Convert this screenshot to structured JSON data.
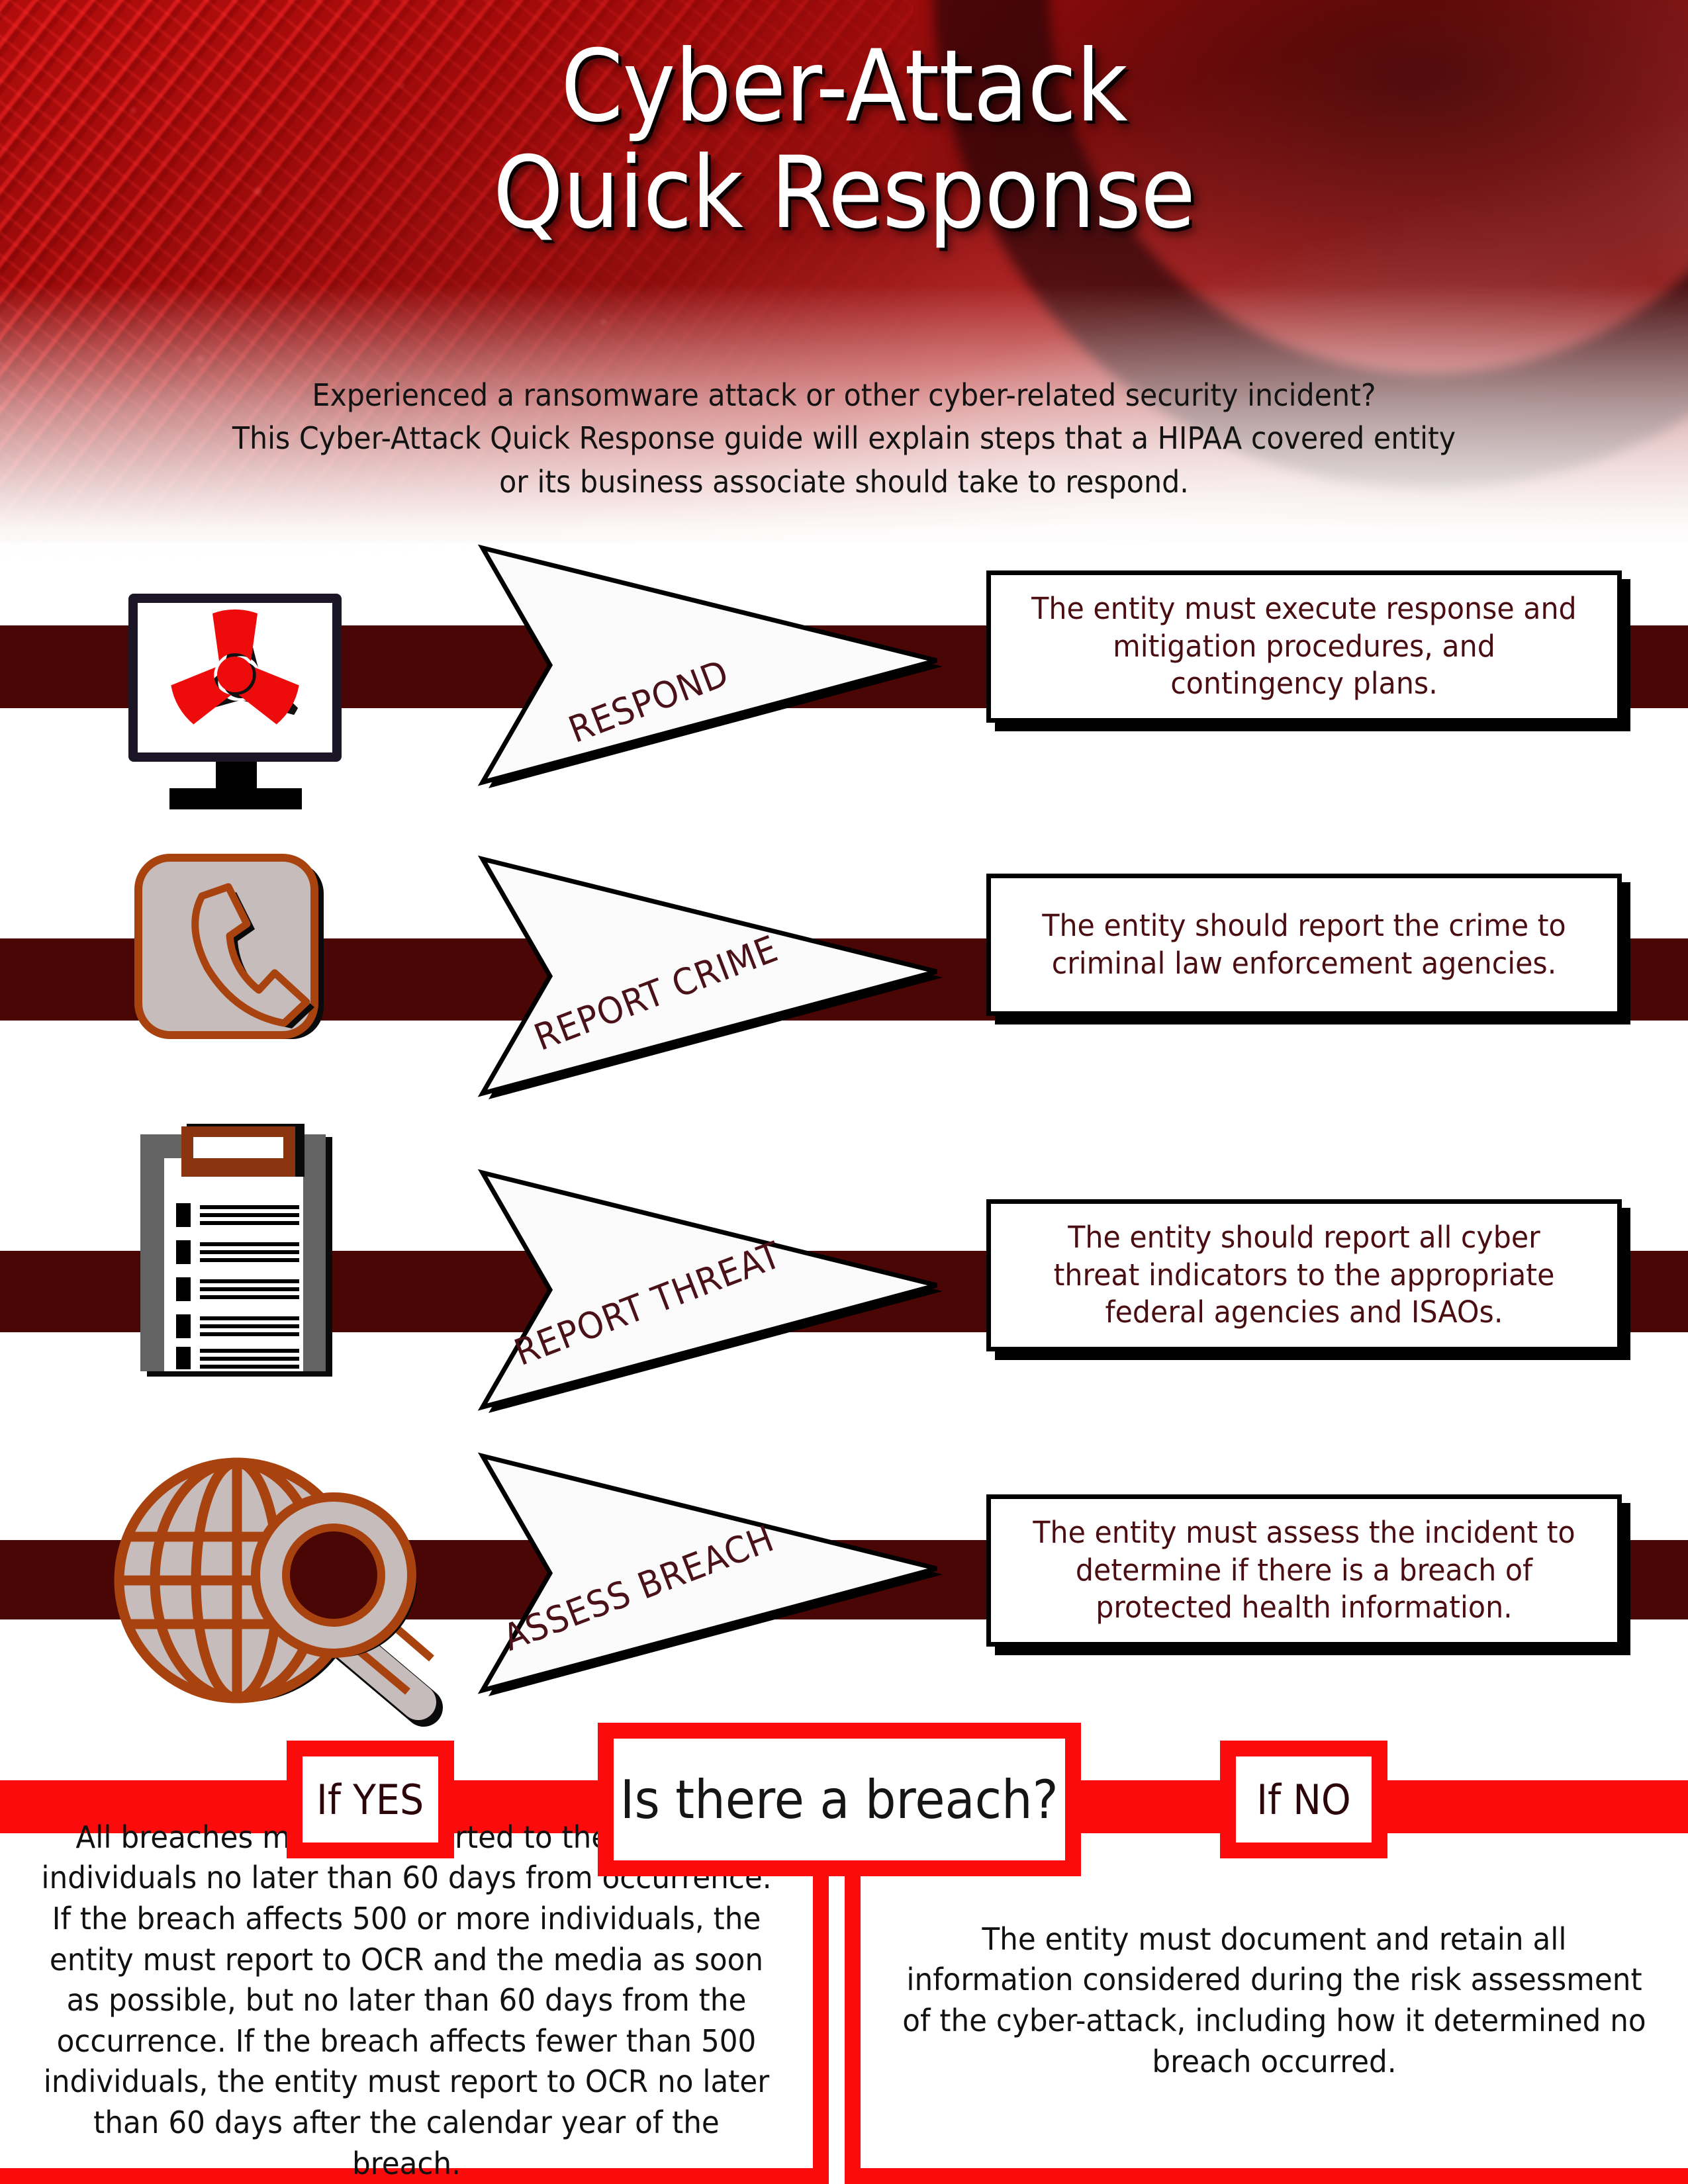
{
  "header": {
    "title_line1": "Cyber-Attack",
    "title_line2": "Quick Response",
    "subtitle_line1": "Experienced a ransomware attack or other cyber-related security incident?",
    "subtitle_line2": "This Cyber-Attack Quick Response guide will explain steps that a HIPAA covered entity",
    "subtitle_line3": "or its business associate should take to respond."
  },
  "colors": {
    "band": "#4A0505",
    "accent_red": "#FB0B0B",
    "body_maroon": "#4A0D12",
    "icon_brown": "#A8430F",
    "icon_gray": "#C6BCBC"
  },
  "steps": [
    {
      "icon": "radiation-monitor-icon",
      "arrow_label": "RESPOND",
      "text": "The entity must execute response and mitigation procedures, and contingency plans."
    },
    {
      "icon": "telephone-icon",
      "arrow_label": "REPORT CRIME",
      "text": "The entity should report the crime to criminal law enforcement agencies."
    },
    {
      "icon": "clipboard-checklist-icon",
      "arrow_label": "REPORT THREAT",
      "text": "The entity should report all cyber threat indicators  to the appropriate federal agencies and ISAOs."
    },
    {
      "icon": "globe-magnifier-icon",
      "arrow_label": "ASSESS BREACH",
      "text": "The entity must assess the incident to determine if there is a breach of protected health information."
    }
  ],
  "decision": {
    "question": "Is there a breach?",
    "yes_label": "If YES",
    "no_label": "If NO",
    "yes_text": "All breaches must be reported to the affected individuals no later than 60 days from occurrence. If the breach affects 500 or more individuals, the entity must report to OCR and the media as soon as possible, but no later than 60 days from the occurrence. If the breach affects fewer than 500 individuals, the entity must report to OCR no later than 60 days after the calendar year of the breach.",
    "no_text": "The entity must document and retain all information considered during the risk assessment of the cyber-attack,  including how it determined no breach occurred."
  }
}
